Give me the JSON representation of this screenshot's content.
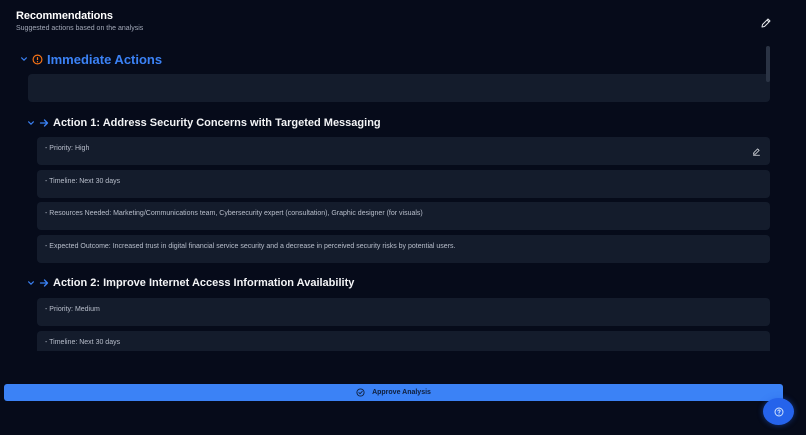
{
  "header": {
    "title": "Recommendations",
    "subtitle": "Suggested actions based on the analysis"
  },
  "section": {
    "title": "Immediate Actions"
  },
  "actions": [
    {
      "title": "Action 1: Address Security Concerns with Targeted Messaging",
      "items": [
        "- Priority: High",
        "- Timeline: Next 30 days",
        "- Resources Needed: Marketing/Communications team, Cybersecurity expert (consultation), Graphic designer (for visuals)",
        "- Expected Outcome: Increased trust in digital financial service security and a decrease in perceived security risks by potential users."
      ]
    },
    {
      "title": "Action 2: Improve Internet Access Information Availability",
      "items": [
        "- Priority: Medium",
        "- Timeline: Next 30 days"
      ]
    }
  ],
  "footer": {
    "approve_label": "Approve Analysis"
  },
  "colors": {
    "accent": "#3b82f6",
    "warning_icon": "#f97316",
    "background": "#060b1a",
    "card": "#141c2c"
  }
}
